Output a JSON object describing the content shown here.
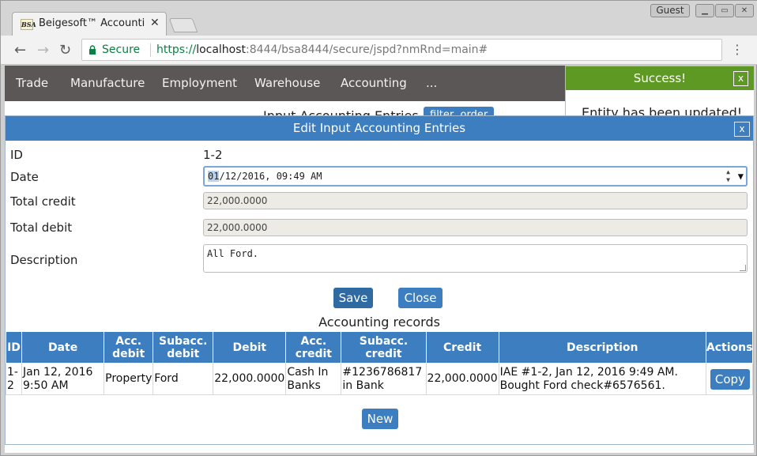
{
  "browser": {
    "tab_title": "Beigesoft™ Accounti",
    "favicon_text": "BSA",
    "guest_label": "Guest",
    "secure_label": "Secure",
    "url_scheme": "https://",
    "url_host": "localhost",
    "url_rest": ":8444/bsa8444/secure/jspd?nmRnd=main#"
  },
  "nav": {
    "items": [
      "Trade",
      "Manufacture",
      "Employment",
      "Warehouse",
      "Accounting",
      "..."
    ]
  },
  "page": {
    "heading": "Input Accounting Entries",
    "filter_label": "filter, order"
  },
  "toast": {
    "title": "Success!",
    "close": "x",
    "message": "Entity has been updated!"
  },
  "dialog": {
    "title": "Edit Input Accounting Entries",
    "close": "x",
    "labels": {
      "id": "ID",
      "date": "Date",
      "total_credit": "Total credit",
      "total_debit": "Total debit",
      "description": "Description"
    },
    "values": {
      "id": "1-2",
      "date_hl": "01",
      "date_rest": "/12/2016, 09:49 AM",
      "total_credit": "22,000.0000",
      "total_debit": "22,000.0000",
      "description": "All Ford."
    },
    "save_label": "Save",
    "close_label": "Close",
    "records_title": "Accounting records",
    "new_label": "New"
  },
  "records": {
    "headers": [
      "ID",
      "Date",
      "Acc. debit",
      "Subacc. debit",
      "Debit",
      "Acc. credit",
      "Subacc. credit",
      "Credit",
      "Description",
      "Actions"
    ],
    "rows": [
      {
        "id": "1-2",
        "date": "Jan 12, 2016 9:50 AM",
        "acc_debit": "Property",
        "subacc_debit": "Ford",
        "debit": "22,000.0000",
        "acc_credit": "Cash In Banks",
        "subacc_credit": "#1236786817 in Bank",
        "credit": "22,000.0000",
        "description": "IAE #1-2, Jan 12, 2016 9:49 AM. Bought Ford check#6576561.",
        "action_label": "Copy"
      }
    ]
  }
}
